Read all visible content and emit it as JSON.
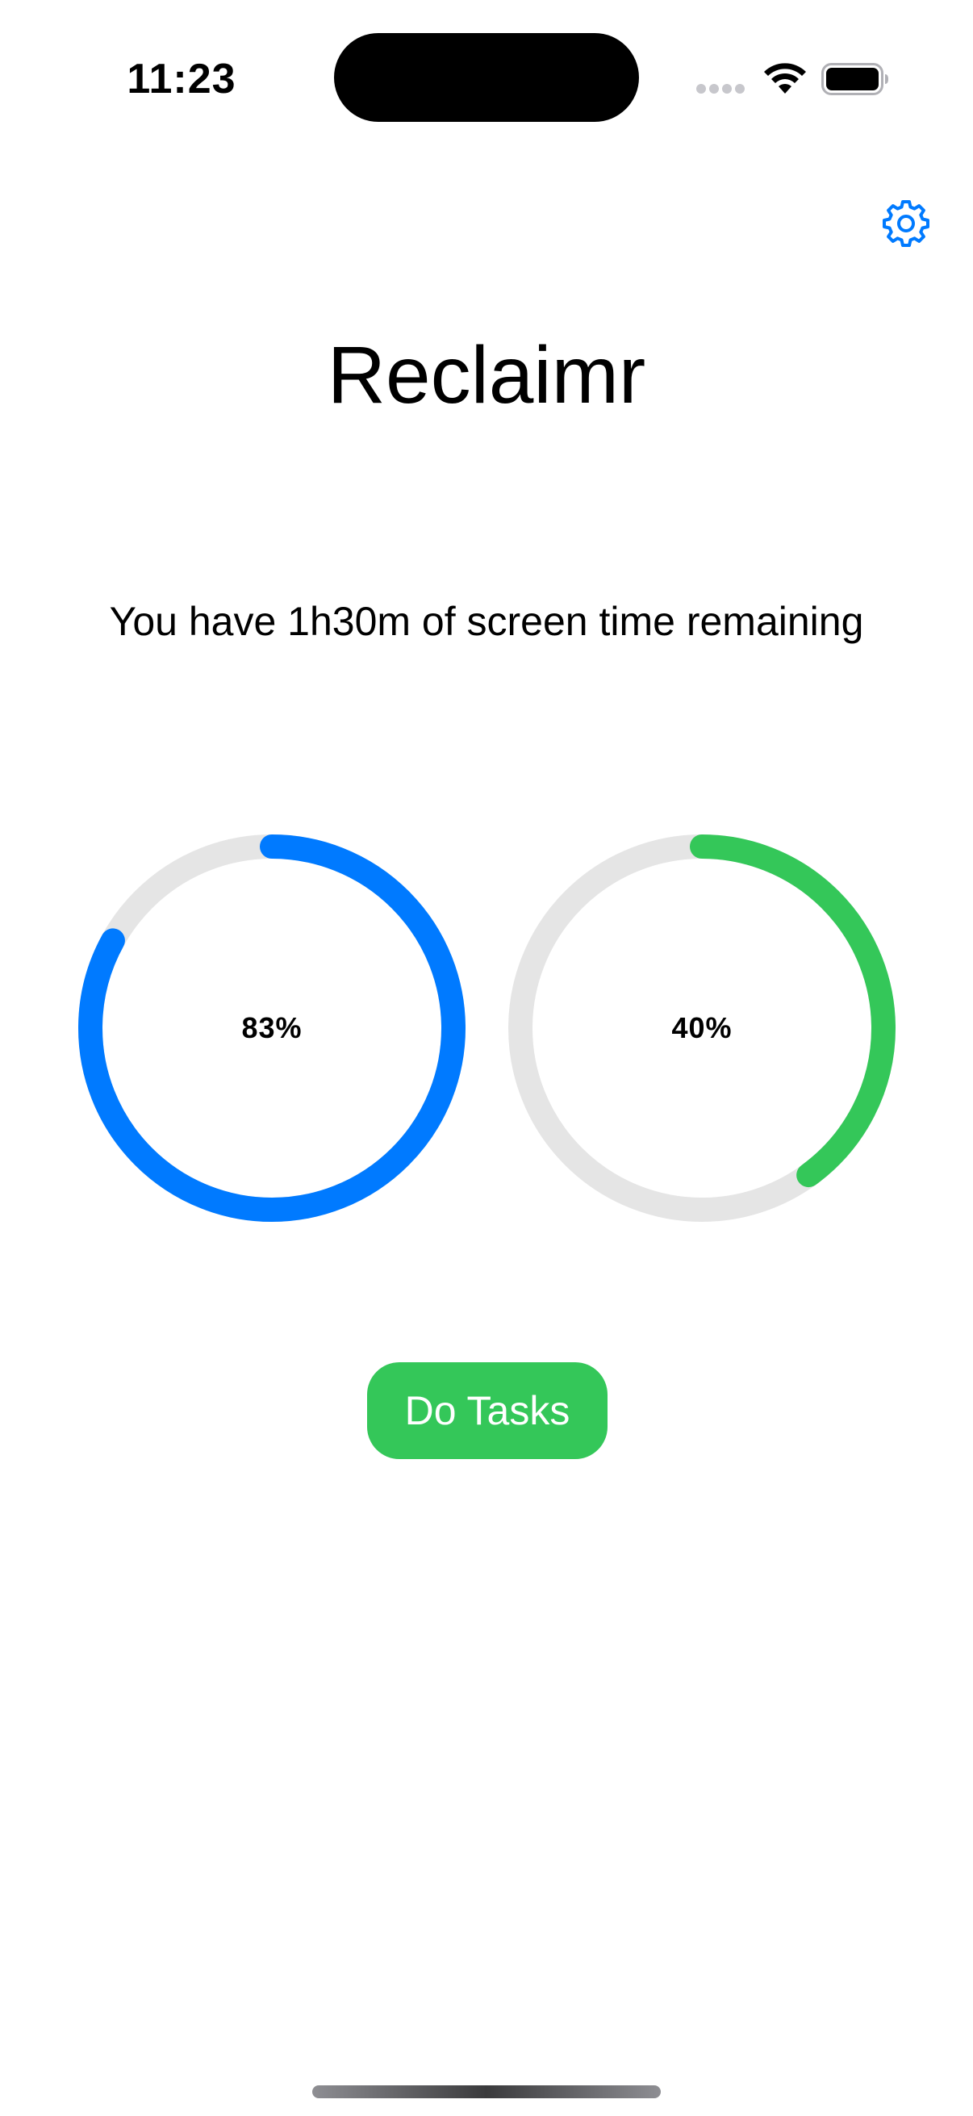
{
  "status_bar": {
    "time": "11:23"
  },
  "header": {
    "settings_icon": "gear-icon",
    "title": "Reclaimr"
  },
  "main": {
    "message": "You have 1h30m of screen time remaining",
    "rings": [
      {
        "label": "83%",
        "progress": 0.83,
        "color": "#007aff",
        "track_color": "#e5e5e5"
      },
      {
        "label": "40%",
        "progress": 0.4,
        "color": "#34c759",
        "track_color": "#e5e5e5"
      }
    ],
    "action_button_label": "Do Tasks",
    "action_button_color": "#34c759"
  },
  "colors": {
    "accent_blue": "#007aff",
    "accent_green": "#34c759"
  }
}
